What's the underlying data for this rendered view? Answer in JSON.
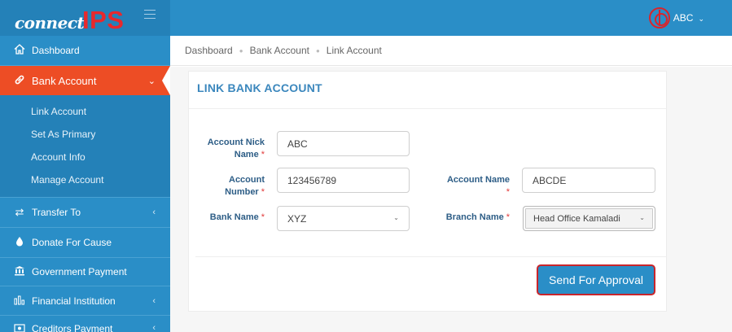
{
  "header": {
    "brand_connect": "connect",
    "brand_ips": "IPS",
    "user_name": "ABC"
  },
  "sidebar": {
    "items": [
      {
        "label": "Dashboard",
        "icon": "home-icon"
      },
      {
        "label": "Bank Account",
        "icon": "link-icon"
      },
      {
        "label": "Transfer To",
        "icon": "transfer-icon"
      },
      {
        "label": "Donate For Cause",
        "icon": "drop-icon"
      },
      {
        "label": "Government Payment",
        "icon": "bank-building-icon"
      },
      {
        "label": "Financial Institution",
        "icon": "bar-chart-icon"
      },
      {
        "label": "Creditors Payment",
        "icon": "money-icon"
      }
    ],
    "submenu": [
      {
        "label": "Link Account"
      },
      {
        "label": "Set As Primary"
      },
      {
        "label": "Account Info"
      },
      {
        "label": "Manage Account"
      }
    ]
  },
  "breadcrumb": [
    "Dashboard",
    "Bank Account",
    "Link Account"
  ],
  "form": {
    "title": "LINK BANK ACCOUNT",
    "nick_label_1": "Account Nick",
    "nick_label_2": "Name",
    "nick_value": "ABC",
    "number_label_1": "Account",
    "number_label_2": "Number",
    "number_value": "123456789",
    "name_label": "Account Name",
    "name_value": "ABCDE",
    "bank_label": "Bank Name",
    "bank_value": "XYZ",
    "branch_label": "Branch Name",
    "branch_value": "Head Office Kamaladi",
    "required_mark": "*",
    "submit_label": "Send For Approval"
  },
  "colors": {
    "primary": "#2a8ec7",
    "active": "#ed4d25",
    "title": "#3b87bd",
    "required": "#e23a3a"
  }
}
